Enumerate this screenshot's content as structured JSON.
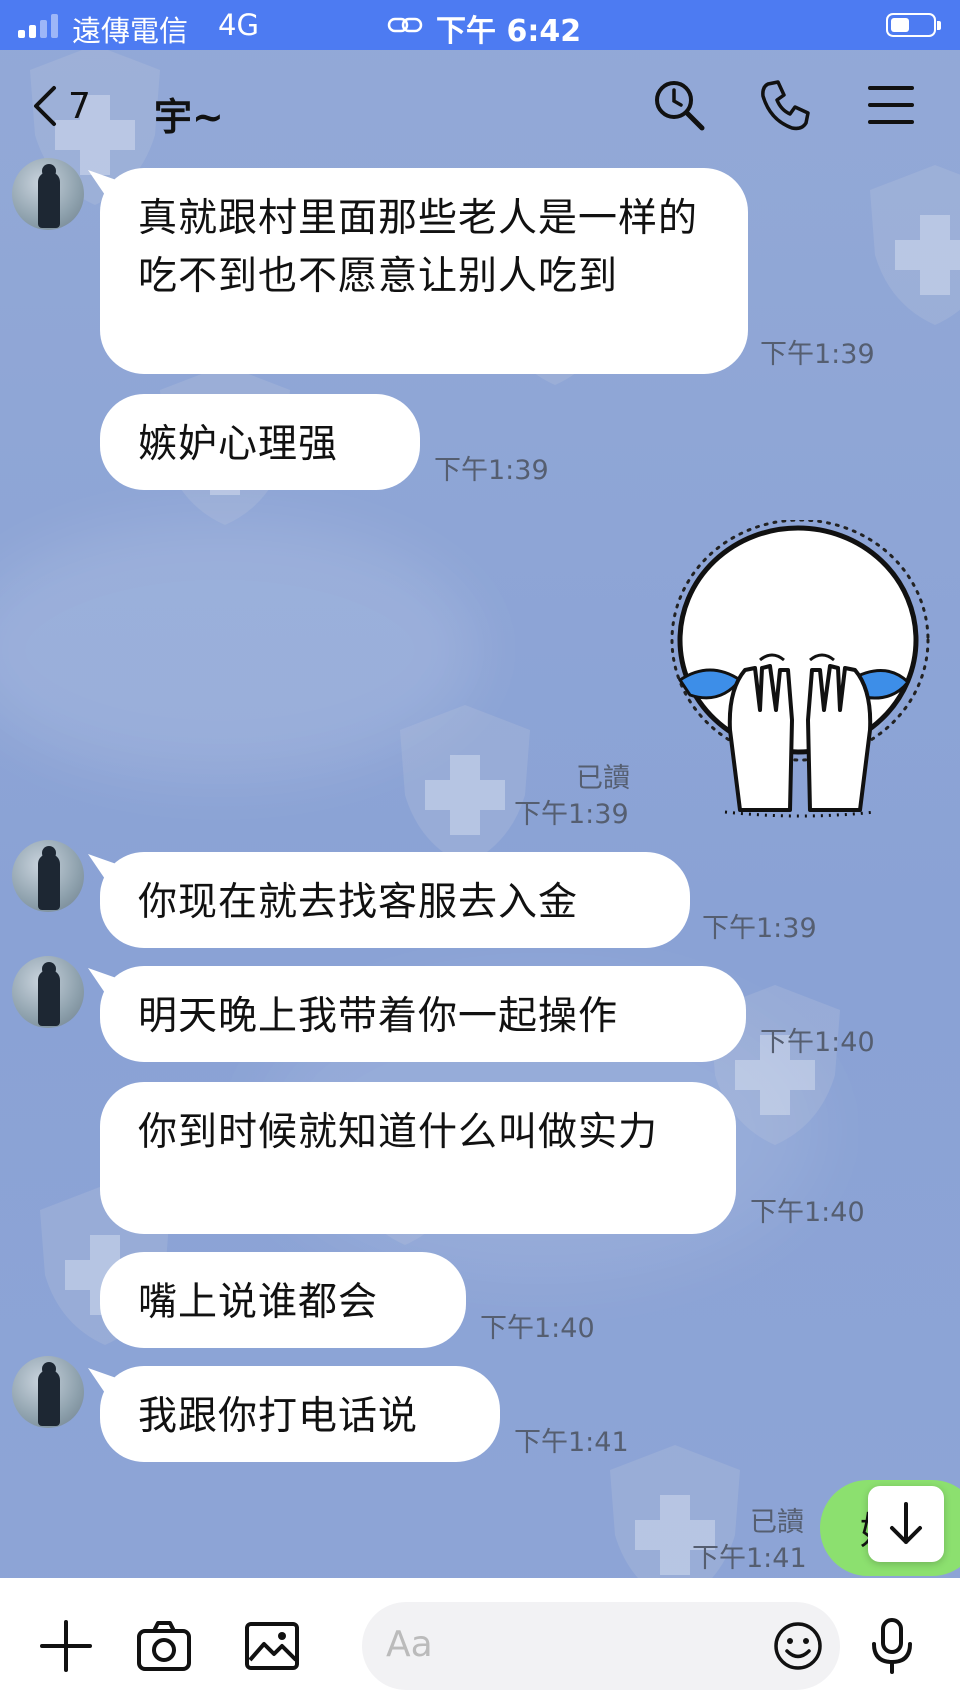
{
  "status_bar": {
    "carrier": "遠傳電信",
    "network": "4G",
    "time": "下午 6:42"
  },
  "header": {
    "back_count": "7",
    "title": "宇~"
  },
  "messages": [
    {
      "text": "真就跟村里面那些老人是一样的 吃不到也不愿意让别人吃到",
      "time": "下午1:39"
    },
    {
      "text": "嫉妒心理强",
      "time": "下午1:39"
    },
    {
      "text": "你现在就去找客服去入金",
      "time": "下午1:39"
    },
    {
      "text": "明天晚上我带着你一起操作",
      "time": "下午1:40"
    },
    {
      "text": "你到时候就知道什么叫做实力",
      "time": "下午1:40"
    },
    {
      "text": "嘴上说谁都会",
      "time": "下午1:40"
    },
    {
      "text": "我跟你打电话说",
      "time": "下午1:41"
    }
  ],
  "sticker_message": {
    "read_label": "已讀",
    "time": "下午1:39"
  },
  "outgoing_partial": {
    "read_label": "已讀",
    "time": "下午1:41",
    "text": "好"
  },
  "input_bar": {
    "placeholder": "Aa"
  },
  "icons": {
    "header": [
      "search-icon",
      "phone-icon",
      "menu-icon"
    ],
    "input_bar": [
      "plus-icon",
      "camera-icon",
      "image-icon",
      "emoji-icon",
      "microphone-icon"
    ],
    "scroll": "arrow-down-icon"
  },
  "colors": {
    "status_bar": "#4d7bf2",
    "chat_background": "#8ea5d6",
    "incoming_bubble": "#ffffff",
    "outgoing_bubble": "#8ce06f"
  }
}
